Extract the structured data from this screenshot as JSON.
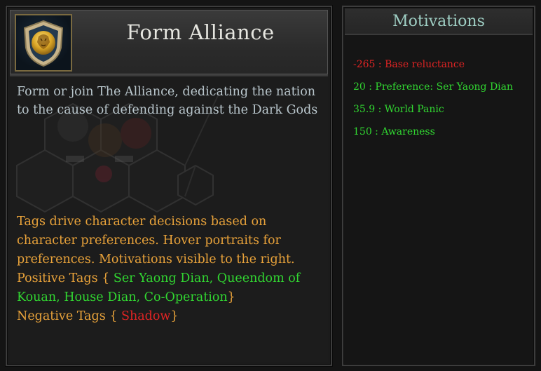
{
  "header": {
    "title": "Form Alliance",
    "icon": "lion-shield-icon"
  },
  "description": "Form or join The Alliance, dedicating the nation to the cause of defending against the Dark Gods",
  "tags": {
    "intro": "Tags drive character decisions based on character preferences. Hover portraits for preferences. Motivations visible to the right.",
    "positive_label": "Positive Tags {",
    "positive_values": "Ser Yaong Dian, Queendom of Kouan, House Dian, Co-Operation",
    "negative_label": "Negative Tags {",
    "negative_values": "Shadow",
    "close_brace": "}"
  },
  "motivations": {
    "title": "Motivations",
    "items": [
      {
        "text": "-265 : Base reluctance",
        "status": "negative"
      },
      {
        "text": "20 : Preference: Ser Yaong Dian",
        "status": "positive"
      },
      {
        "text": "35.9 : World Panic",
        "status": "positive"
      },
      {
        "text": "150 : Awareness",
        "status": "positive"
      }
    ]
  },
  "colors": {
    "positive": "#31d631",
    "negative": "#e02424",
    "tag_text": "#e8a23a",
    "description": "#b9c6cc",
    "motivations_title": "#9fcfc4"
  }
}
